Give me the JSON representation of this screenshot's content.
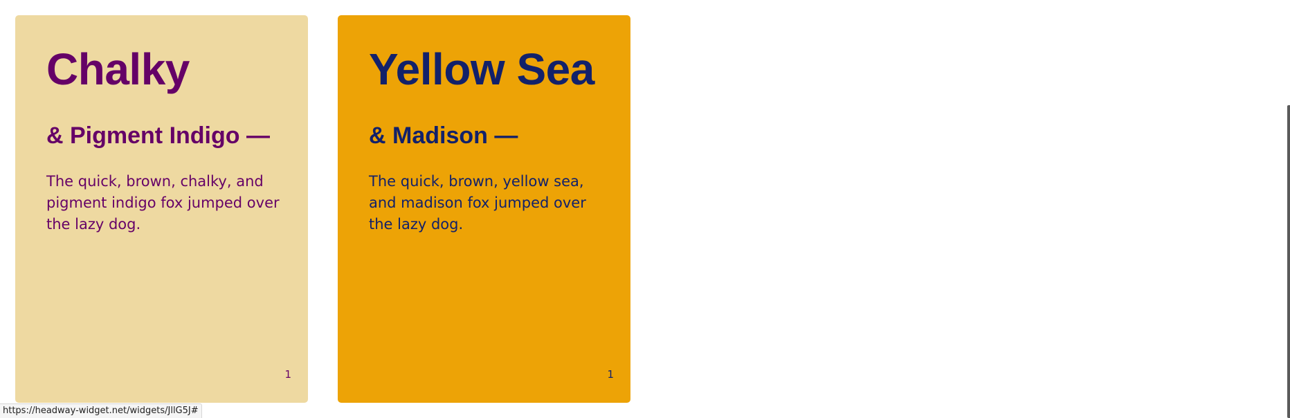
{
  "cards": [
    {
      "title": "Chalky",
      "subtitle": "& Pigment Indigo —",
      "body": "The quick, brown, chalky, and pigment indigo fox jumped over the lazy dog.",
      "page_number": "1",
      "background_color": "#eed9a1",
      "text_color": "#650167"
    },
    {
      "title": "Yellow Sea",
      "subtitle": "& Madison —",
      "body": "The quick, brown, yellow sea, and madison fox jumped over the lazy dog.",
      "page_number": "1",
      "background_color": "#eda306",
      "text_color": "#12216a"
    }
  ],
  "status_bar": {
    "url": "https://headway-widget.net/widgets/JllG5J#"
  }
}
